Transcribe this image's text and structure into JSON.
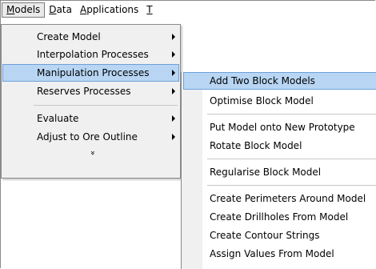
{
  "menubar": {
    "items": [
      {
        "label": "Models",
        "active": true
      },
      {
        "label": "Data"
      },
      {
        "label": "Applications"
      },
      {
        "label": "T"
      }
    ]
  },
  "models_menu": {
    "items": [
      {
        "label": "Create Model"
      },
      {
        "label": "Interpolation Processes"
      },
      {
        "label": "Manipulation Processes",
        "highlighted": true
      },
      {
        "label": "Reserves Processes"
      },
      {
        "label": "Evaluate"
      },
      {
        "label": "Adjust to Ore Outline"
      }
    ],
    "more_icon": "chevron-double-down-icon"
  },
  "manipulation_submenu": {
    "items": [
      {
        "label": "Add Two Block Models",
        "highlighted": true
      },
      {
        "label": "Optimise Block Model"
      },
      {
        "label": "Put Model onto New Prototype"
      },
      {
        "label": "Rotate Block Model"
      },
      {
        "label": "Regularise Block Model"
      },
      {
        "label": "Create Perimeters Around Model"
      },
      {
        "label": "Create Drillholes From Model"
      },
      {
        "label": "Create Contour Strings"
      },
      {
        "label": "Assign Values From Model"
      }
    ]
  },
  "colors": {
    "highlight_bg": "#b8d6f4",
    "highlight_border": "#6ea0d8",
    "menu_bg": "#f0f0f0"
  }
}
